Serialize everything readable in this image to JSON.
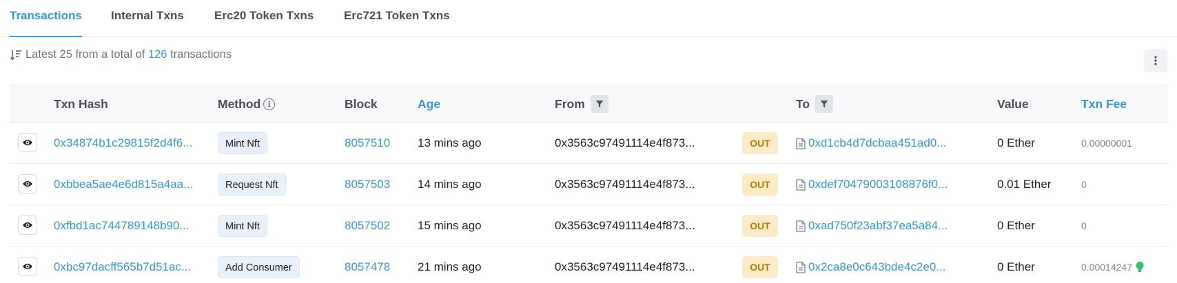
{
  "tabs": [
    "Transactions",
    "Internal Txns",
    "Erc20 Token Txns",
    "Erc721 Token Txns"
  ],
  "summary": {
    "prefix": "Latest 25 from a total of",
    "total": "126",
    "suffix": "transactions"
  },
  "columns": {
    "txn_hash": "Txn Hash",
    "method": "Method",
    "block": "Block",
    "age": "Age",
    "from": "From",
    "to": "To",
    "value": "Value",
    "txn_fee": "Txn Fee"
  },
  "rows": [
    {
      "hash": "0x34874b1c29815f2d4f6...",
      "method": "Mint Nft",
      "block": "8057510",
      "age": "13 mins ago",
      "from": "0x3563c97491114e4f873...",
      "direction": "OUT",
      "to": "0xd1cb4d7dcbaa451ad0...",
      "value": "0 Ether",
      "fee": "0.00000001"
    },
    {
      "hash": "0xbbea5ae4e6d815a4aa...",
      "method": "Request Nft",
      "block": "8057503",
      "age": "14 mins ago",
      "from": "0x3563c97491114e4f873...",
      "direction": "OUT",
      "to": "0xdef70479003108876f0...",
      "value": "0.01 Ether",
      "fee": "0"
    },
    {
      "hash": "0xfbd1ac744789148b90...",
      "method": "Mint Nft",
      "block": "8057502",
      "age": "15 mins ago",
      "from": "0x3563c97491114e4f873...",
      "direction": "OUT",
      "to": "0xad750f23abf37ea5a84...",
      "value": "0 Ether",
      "fee": "0"
    },
    {
      "hash": "0xbc97dacff565b7d51ac...",
      "method": "Add Consumer",
      "block": "8057478",
      "age": "21 mins ago",
      "from": "0x3563c97491114e4f873...",
      "direction": "OUT",
      "to": "0x2ca8e0c643bde4c2e0...",
      "value": "0 Ether",
      "fee": "0.00014247"
    }
  ],
  "icons": {
    "sort": "sort-desc-icon",
    "more": "vertical-dots-icon",
    "filter": "funnel-icon",
    "info": "info-icon",
    "eye": "eye-icon",
    "contract": "document-icon",
    "fee_indicator": "lightbulb-icon"
  },
  "colors": {
    "accent": "#3498db",
    "out_badge_bg": "#fcebc6",
    "out_badge_text": "#b47d00",
    "method_bg": "#e8f0fa",
    "bulb": "#3cbf6a"
  }
}
